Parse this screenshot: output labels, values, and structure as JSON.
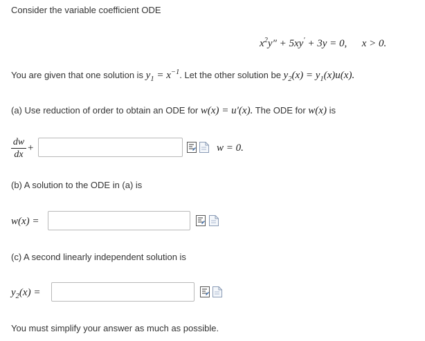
{
  "intro": "Consider the variable coefficient ODE",
  "ode": {
    "lhs_x": "x",
    "lhs_pow": "2",
    "lhs_y": "y″ + 5",
    "lhs_xy": "xy",
    "lhs_prime": "′",
    "lhs_rest": " + 3y = 0,",
    "cond": "x > 0."
  },
  "given": {
    "text_before": "You are given that one solution is ",
    "y1_lhs": "y",
    "y1_sub": "1",
    "y1_eq": " = x",
    "y1_pow": "−1",
    "text_mid": ". Let the other solution be ",
    "y2_def": "y",
    "y2_sub": "2",
    "y2_rest_a": "(x) = y",
    "y2_rest_sub": "1",
    "y2_rest_b": "(x)u(x).",
    "end": ""
  },
  "part_a": {
    "text": "(a) Use reduction of order to obtain an ODE for ",
    "w_expr": "w(x) = u′(x).",
    "text2": " The ODE for ",
    "w_var": "w(x)",
    "text3": " is",
    "frac_num": "dw",
    "frac_den": "dx",
    "plus": "+",
    "answer": "",
    "after": "w = 0."
  },
  "part_b": {
    "text": "(b) A solution to the ODE in (a) is",
    "label": "w(x) =",
    "answer": ""
  },
  "part_c": {
    "text": "(c) A second linearly independent solution is",
    "label_y": "y",
    "label_sub": "2",
    "label_rest": "(x) =",
    "answer": ""
  },
  "footer": "You must simplify your answer as much as possible.",
  "icons": [
    "equation-editor-icon",
    "preview-icon"
  ]
}
